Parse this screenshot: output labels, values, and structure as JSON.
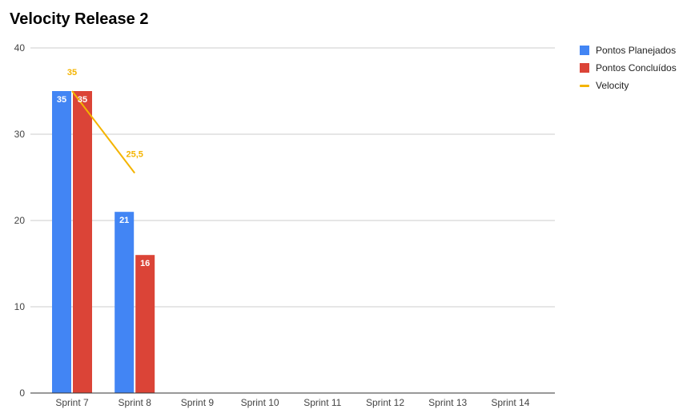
{
  "chart_data": {
    "type": "bar",
    "title": "Velocity Release 2",
    "categories": [
      "Sprint 7",
      "Sprint 8",
      "Sprint 9",
      "Sprint 10",
      "Sprint 11",
      "Sprint 12",
      "Sprint 13",
      "Sprint 14"
    ],
    "series": [
      {
        "name": "Pontos Planejados",
        "kind": "bar",
        "color": "#4285F4",
        "values": [
          35,
          21,
          null,
          null,
          null,
          null,
          null,
          null
        ],
        "labels": [
          "35",
          "21",
          "",
          "",
          "",
          "",
          "",
          ""
        ]
      },
      {
        "name": "Pontos Concluídos",
        "kind": "bar",
        "color": "#DB4437",
        "values": [
          35,
          16,
          null,
          null,
          null,
          null,
          null,
          null
        ],
        "labels": [
          "35",
          "16",
          "",
          "",
          "",
          "",
          "",
          ""
        ]
      },
      {
        "name": "Velocity",
        "kind": "line",
        "color": "#F4B400",
        "values": [
          35,
          25.5,
          null,
          null,
          null,
          null,
          null,
          null
        ],
        "labels": [
          "35",
          "25,5",
          "",
          "",
          "",
          "",
          "",
          ""
        ]
      }
    ],
    "ylim": [
      0,
      40
    ],
    "yticks": [
      "0",
      "10",
      "20",
      "30",
      "40"
    ],
    "grid": true,
    "legend_position": "right"
  }
}
